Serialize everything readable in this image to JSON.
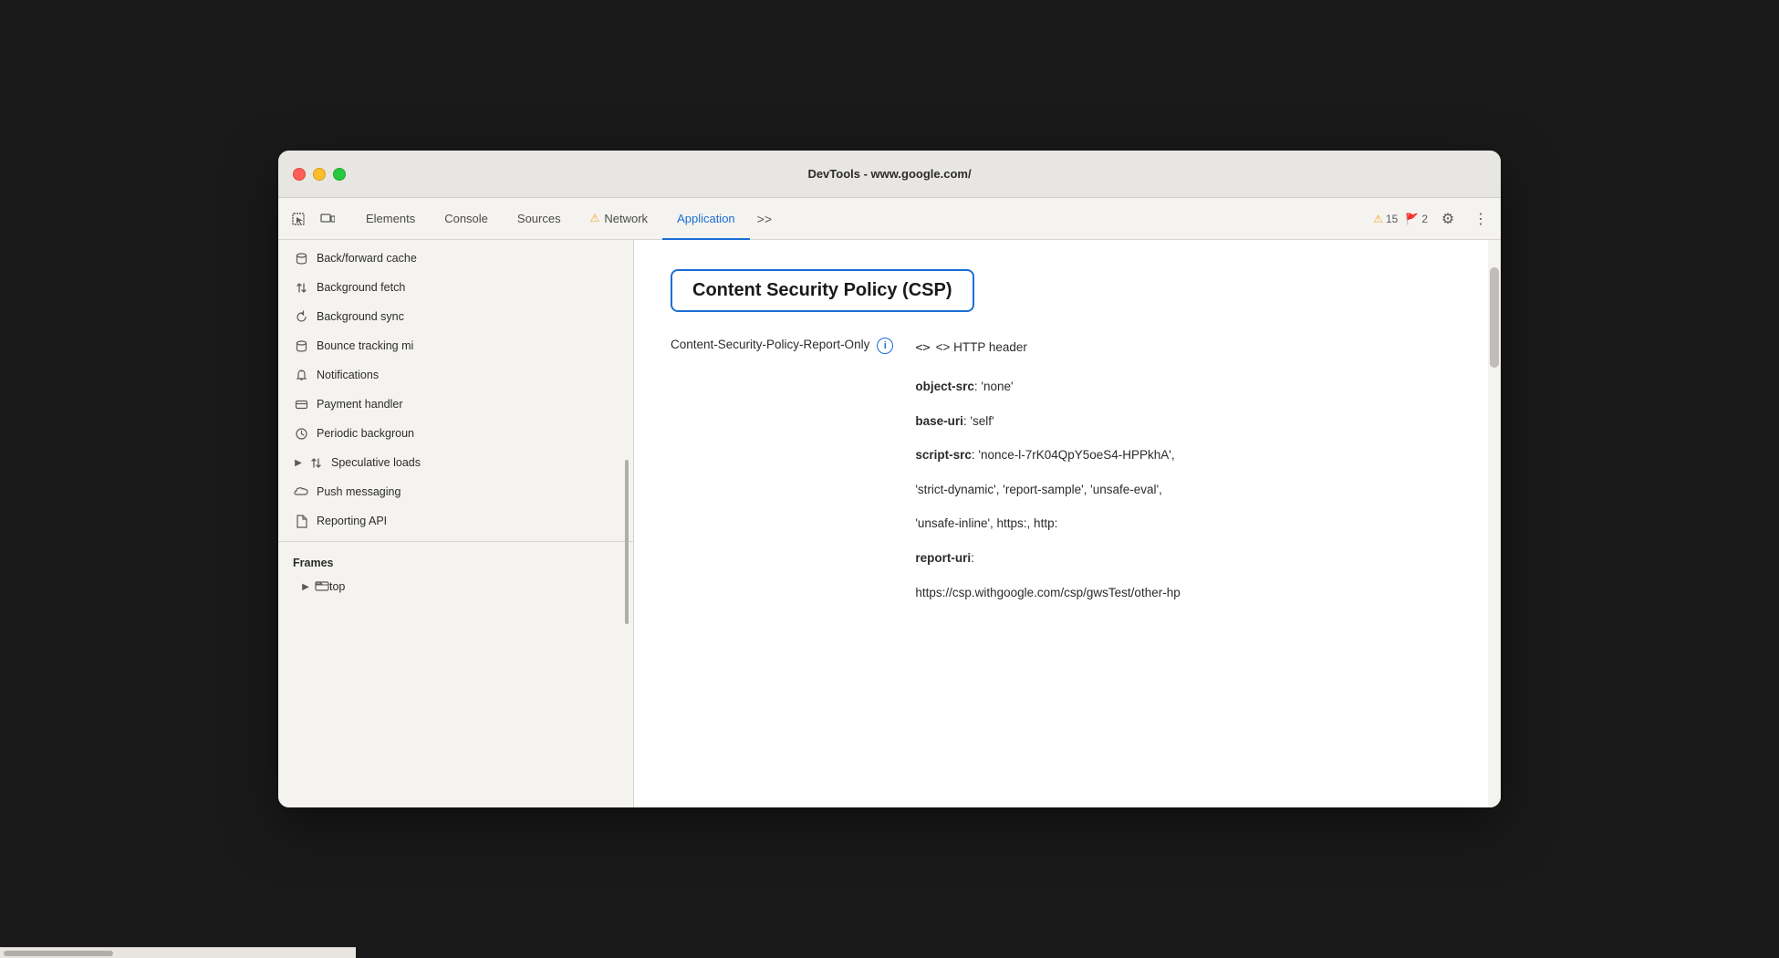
{
  "titlebar": {
    "title": "DevTools - www.google.com/"
  },
  "toolbar": {
    "tabs": [
      {
        "id": "elements",
        "label": "Elements",
        "active": false,
        "warning": false
      },
      {
        "id": "console",
        "label": "Console",
        "active": false,
        "warning": false
      },
      {
        "id": "sources",
        "label": "Sources",
        "active": false,
        "warning": false
      },
      {
        "id": "network",
        "label": "Network",
        "active": false,
        "warning": true
      },
      {
        "id": "application",
        "label": "Application",
        "active": true,
        "warning": false
      }
    ],
    "more_tabs": ">>",
    "warning_count": "15",
    "error_count": "2"
  },
  "sidebar": {
    "items": [
      {
        "id": "back-forward-cache",
        "label": "Back/forward cache",
        "icon": "cylinder"
      },
      {
        "id": "background-fetch",
        "label": "Background fetch",
        "icon": "arrows-up-down"
      },
      {
        "id": "background-sync",
        "label": "Background sync",
        "icon": "sync"
      },
      {
        "id": "bounce-tracking",
        "label": "Bounce tracking mi",
        "icon": "cylinder"
      },
      {
        "id": "notifications",
        "label": "Notifications",
        "icon": "bell"
      },
      {
        "id": "payment-handler",
        "label": "Payment handler",
        "icon": "card"
      },
      {
        "id": "periodic-background",
        "label": "Periodic backgroun",
        "icon": "clock"
      },
      {
        "id": "speculative-loads",
        "label": "Speculative loads",
        "icon": "arrows-up-down",
        "expand": true
      },
      {
        "id": "push-messaging",
        "label": "Push messaging",
        "icon": "cloud"
      },
      {
        "id": "reporting-api",
        "label": "Reporting API",
        "icon": "file"
      }
    ],
    "frames_label": "Frames",
    "frames_top_label": "top"
  },
  "content": {
    "csp_title": "Content Security Policy (CSP)",
    "policy_label": "Content-Security-Policy-Report-Only",
    "http_header": "<> HTTP header",
    "policies": [
      {
        "key": "object-src",
        "value": ": 'none'"
      },
      {
        "key": "base-uri",
        "value": ": 'self'"
      },
      {
        "key": "script-src",
        "value": ": 'nonce-l-7rK04QpY5oeS4-HPPkhA',"
      },
      {
        "key": "",
        "value": "'strict-dynamic', 'report-sample', 'unsafe-eval',"
      },
      {
        "key": "",
        "value": "'unsafe-inline', https:, http:"
      },
      {
        "key": "report-uri",
        "value": ":"
      },
      {
        "key": "",
        "value": "https://csp.withgoogle.com/csp/gwsTest/other-hp"
      }
    ]
  },
  "icons": {
    "cursor": "⊹",
    "layers": "⬚",
    "gear": "⚙",
    "more": "⋮",
    "warning": "⚠",
    "info": "i",
    "expand_right": "▶",
    "cylinder": "⊕",
    "arrows": "⇅",
    "sync": "↺",
    "bell": "🔔",
    "card": "▬",
    "clock": "◷",
    "cloud": "☁",
    "file": "📄",
    "folder": "▭"
  }
}
